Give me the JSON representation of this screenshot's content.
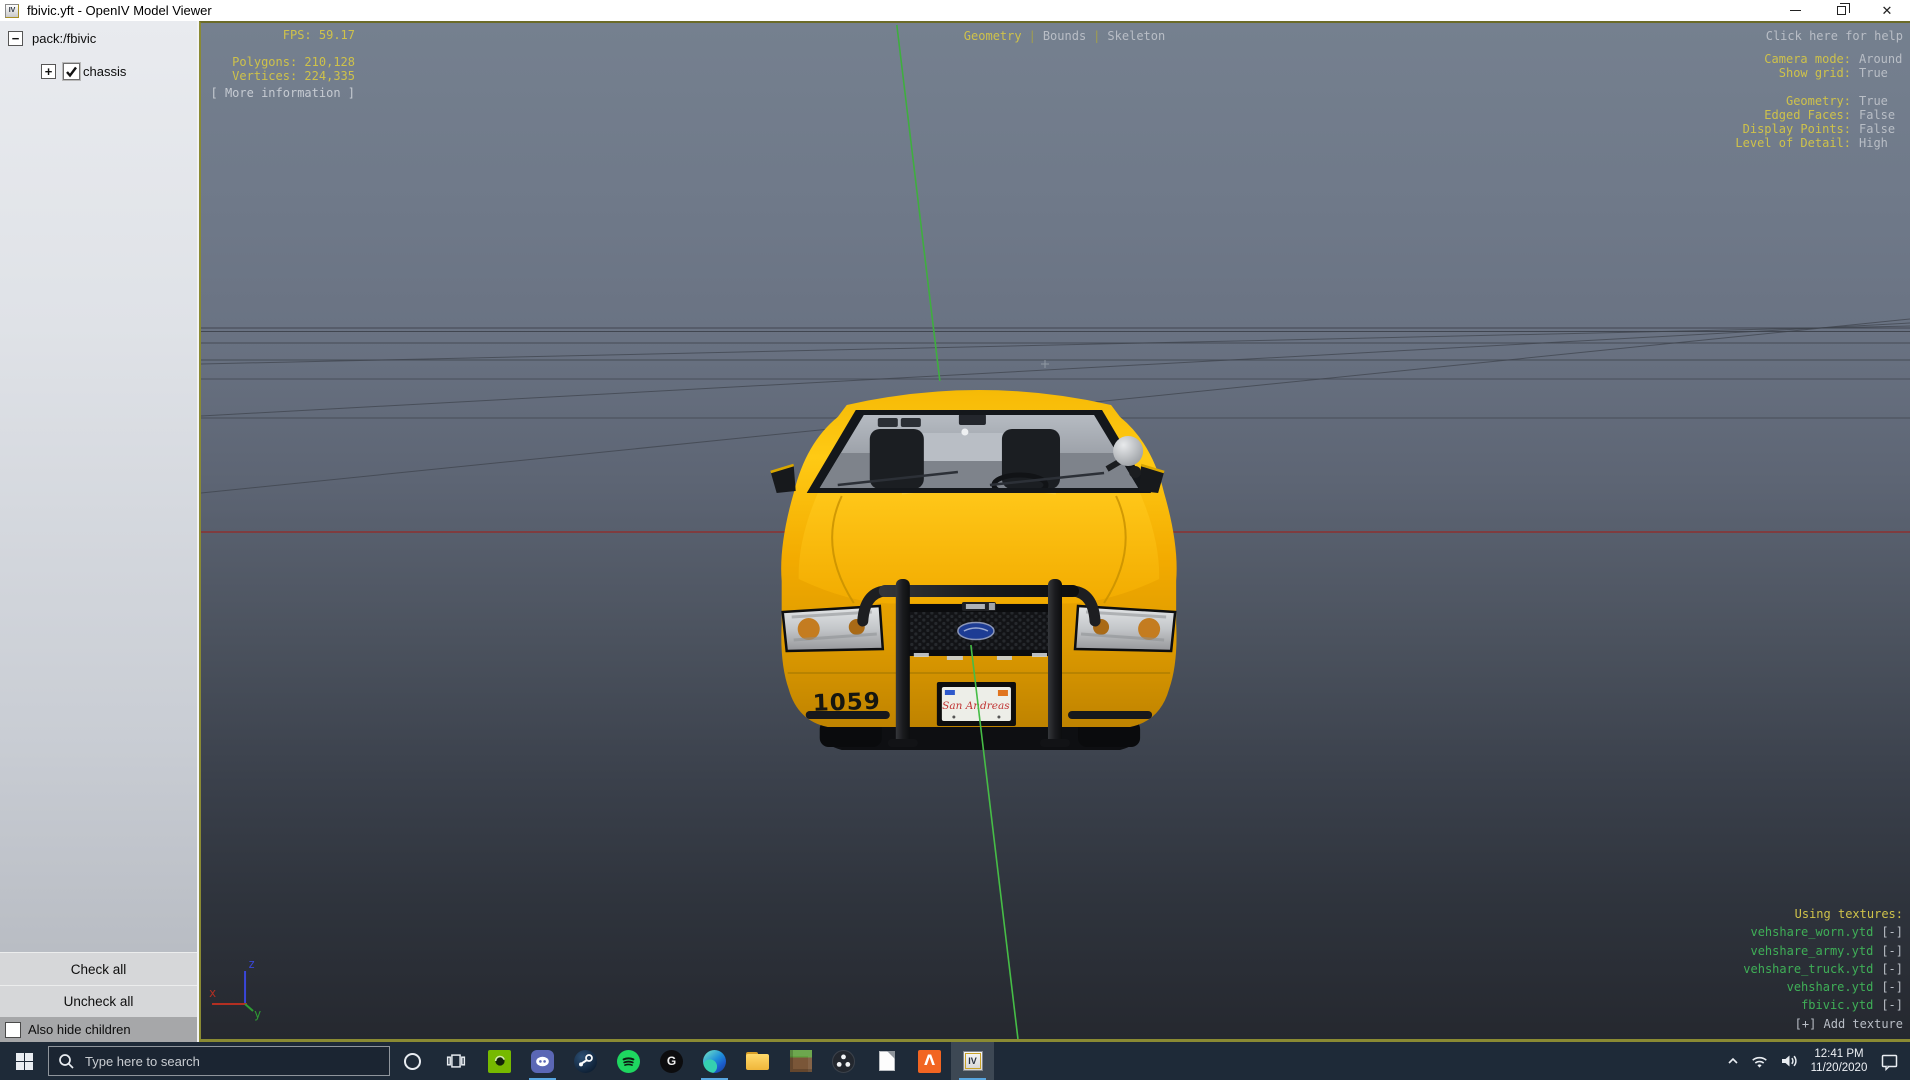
{
  "window": {
    "title": "fbivic.yft - OpenIV Model Viewer"
  },
  "icons": {
    "close": "✕",
    "minus_expander": "−",
    "plus_expander": "+",
    "logitech": "G",
    "fivem": "Λ",
    "openiv": "IV",
    "openiv_small": "IV"
  },
  "sidebar": {
    "root_label": "pack:/fbivic",
    "child_label": "chassis",
    "check_all": "Check all",
    "uncheck_all": "Uncheck all",
    "also_hide_children": "Also hide children"
  },
  "viewport": {
    "fps": "FPS: 59.17",
    "polygons": "Polygons: 210,128",
    "vertices": "Vertices: 224,335",
    "more_info": "[ More information ]",
    "tab_separator": "|",
    "tabs": [
      {
        "label": "Geometry"
      },
      {
        "label": "Bounds"
      },
      {
        "label": "Skeleton"
      }
    ],
    "active_tab": "Geometry",
    "help": "Click here for help",
    "settings": [
      {
        "label": "Camera mode:",
        "value": "Around"
      },
      {
        "label": "Show grid:",
        "value": "True"
      },
      {
        "label": "Geometry:",
        "value": "True"
      },
      {
        "label": "Edged Faces:",
        "value": "False"
      },
      {
        "label": "Display Points:",
        "value": "False"
      },
      {
        "label": "Level of Detail:",
        "value": "High"
      }
    ],
    "textures_title": "Using textures:",
    "textures": [
      {
        "name": "vehshare_worn.ytd",
        "action": "[-]"
      },
      {
        "name": "vehshare_army.ytd",
        "action": "[-]"
      },
      {
        "name": "vehshare_truck.ytd",
        "action": "[-]"
      },
      {
        "name": "vehshare.ytd",
        "action": "[-]"
      },
      {
        "name": "fbivic.ytd",
        "action": "[-]"
      }
    ],
    "add_texture": "[+] Add texture",
    "axis": {
      "x": "x",
      "y": "y",
      "z": "z"
    },
    "model": {
      "unit_number": "1059",
      "license_plate": "San Andreas"
    }
  },
  "taskbar": {
    "search_placeholder": "Type here to search",
    "tray": {
      "time": "12:41 PM",
      "date": "11/20/2020"
    }
  },
  "colors": {
    "overlay_yellow": "#cfc24a",
    "overlay_gray": "#b9bec6",
    "texture_green": "#3faf57",
    "taxi_yellow": "#f3ab00",
    "axis_x_red": "#b32f22",
    "axis_y_green": "#2f9e33",
    "axis_z_blue": "#3946d8",
    "grid_red_line": "#8c3030",
    "grid_green_line": "#3fae3f",
    "taskbar_bg": "#1e2a38",
    "underline_blue": "#58a6e0",
    "viewport_border_olive": "#8a8a33"
  }
}
